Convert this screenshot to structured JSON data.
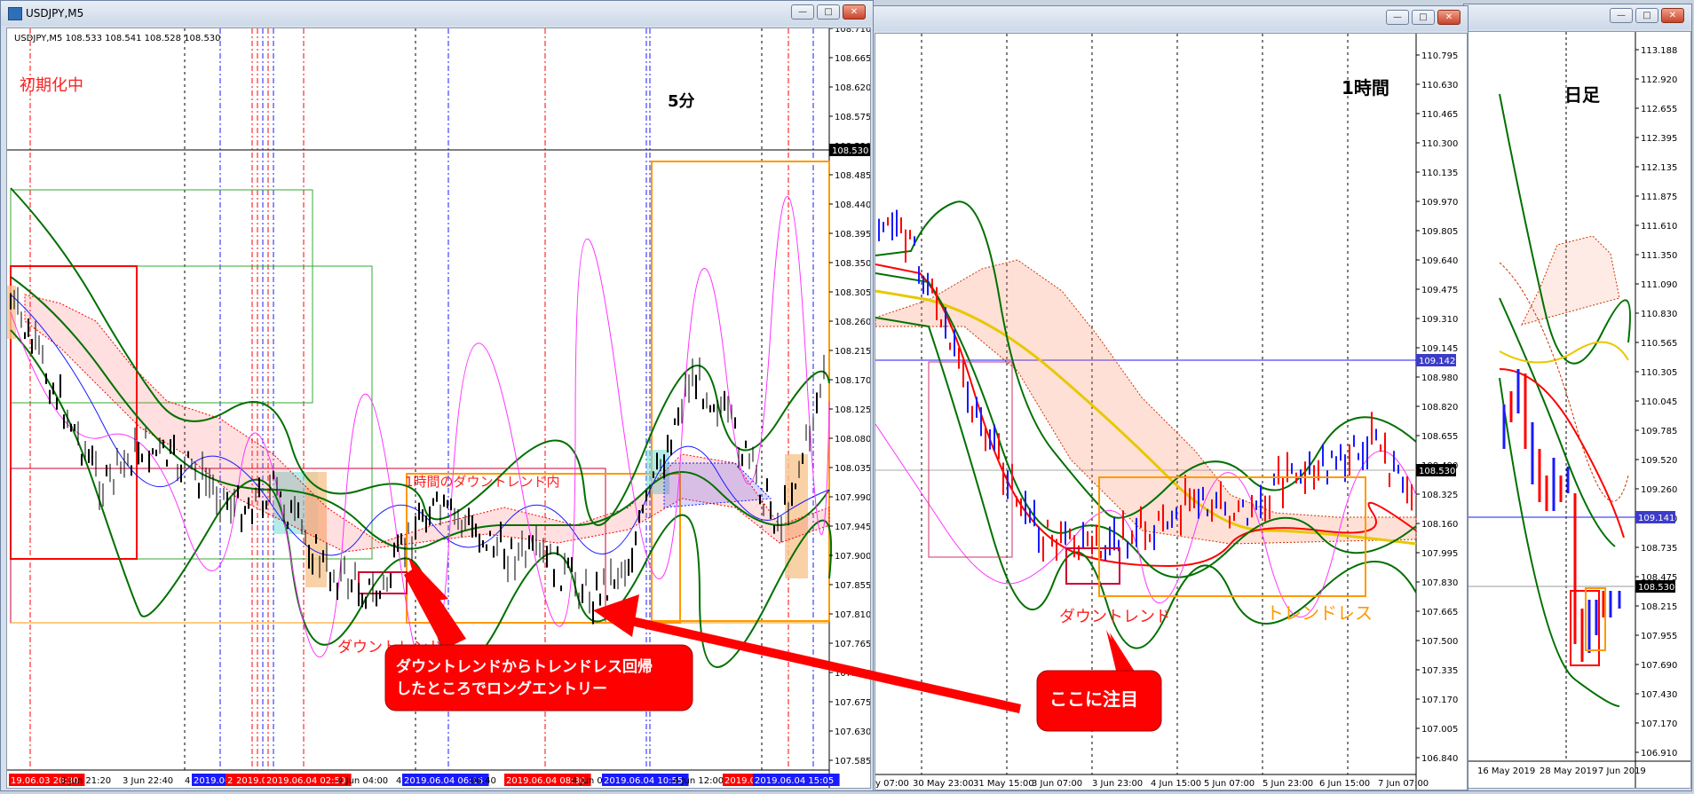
{
  "windows": [
    {
      "title": "USDJPY,M5",
      "info_line": "USDJPY,M5  108.533 108.541 108.528 108.530",
      "status_text": "初期化中",
      "label": "5分",
      "annotation": "1時間のダウントレンド内",
      "downtrend_label": "ダウントレンド",
      "current_price": "108.530",
      "price_ticks": [
        "108.710",
        "108.665",
        "108.620",
        "108.575",
        "108.530",
        "108.485",
        "108.440",
        "108.395",
        "108.350",
        "108.305",
        "108.260",
        "108.215",
        "108.170",
        "108.125",
        "108.080",
        "108.035",
        "107.990",
        "107.945",
        "107.900",
        "107.855",
        "107.810",
        "107.765",
        "107.720",
        "107.675",
        "107.630",
        "107.585"
      ],
      "time_labels": [
        "19.06.03 20:30",
        "3 Jun 21:20",
        "3 Jun 22:40",
        "4",
        "2019.06.0",
        "2",
        "2019.06",
        "2019.06.04 02:50",
        "4 Jun 04:00",
        "4",
        "2019.06.04 06:15",
        "06:40",
        "2019.06.04 08:30",
        "4 Jun 09:",
        "2019.06.04 10:55",
        "4 Jun 12:00",
        "2019.06.0",
        "2019.06.04 15:05"
      ]
    },
    {
      "title": "",
      "label": "1時間",
      "downtrend_label": "ダウントレンド",
      "trendless_label": "トレンドレス",
      "level_price": "109.142",
      "current_price": "108.530",
      "price_ticks": [
        "110.795",
        "110.630",
        "110.465",
        "110.300",
        "110.135",
        "109.970",
        "109.805",
        "109.640",
        "109.475",
        "109.310",
        "109.145",
        "108.980",
        "108.820",
        "108.655",
        "108.490",
        "108.325",
        "108.160",
        "107.995",
        "107.830",
        "107.665",
        "107.500",
        "107.335",
        "107.170",
        "107.005",
        "106.840"
      ],
      "time_labels": [
        "y 07:00",
        "30 May 23:00",
        "31 May 15:00",
        "3 Jun 07:00",
        "3 Jun 23:00",
        "4 Jun 15:00",
        "5 Jun 07:00",
        "5 Jun 23:00",
        "6 Jun 15:00",
        "7 Jun 07:00"
      ]
    },
    {
      "title": "",
      "label": "日足",
      "level_price": "109.141",
      "current_price": "108.530",
      "price_ticks": [
        "113.188",
        "112.920",
        "112.655",
        "112.395",
        "112.135",
        "111.875",
        "111.610",
        "111.350",
        "111.090",
        "110.830",
        "110.565",
        "110.305",
        "110.045",
        "109.785",
        "109.520",
        "109.260",
        "109.000",
        "108.735",
        "108.475",
        "108.215",
        "107.955",
        "107.690",
        "107.430",
        "107.170",
        "106.910"
      ],
      "time_labels": [
        "16 May 2019",
        "28 May 2019",
        "7 Jun 2019"
      ]
    }
  ],
  "callouts": {
    "long_entry": [
      "ダウントレンドからトレンドレス回帰",
      "したところでロングエントリー"
    ],
    "focus": "ここに注目"
  },
  "colors": {
    "bull": "#1a1aff",
    "bear": "#ff0000",
    "bb": "#007000",
    "ichimoku": "#cc3300",
    "highlight": "#ff0000",
    "orange": "#ff9900"
  }
}
